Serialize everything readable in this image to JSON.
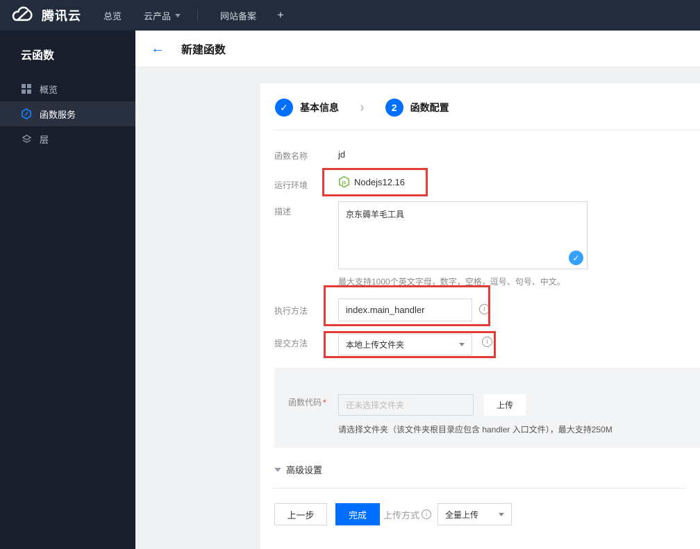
{
  "topnav": {
    "brand": "腾讯云",
    "items": [
      {
        "label": "总览"
      },
      {
        "label": "云产品"
      },
      {
        "label": "网站备案"
      },
      {
        "label": "+"
      }
    ]
  },
  "sidebar": {
    "title": "云函数",
    "items": [
      {
        "label": "概览",
        "icon": "grid-icon",
        "active": false
      },
      {
        "label": "函数服务",
        "icon": "function-hexagon-icon",
        "active": true
      },
      {
        "label": "层",
        "icon": "layers-icon",
        "active": false
      }
    ]
  },
  "header": {
    "back": "←",
    "title": "新建函数"
  },
  "steps": [
    {
      "num": "✓",
      "label": "基本信息",
      "state": "done"
    },
    {
      "num": "2",
      "label": "函数配置",
      "state": "current"
    }
  ],
  "form": {
    "name_label": "函数名称",
    "name_value": "jd",
    "runtime_label": "运行环境",
    "runtime_value": "Nodejs12.16",
    "runtime_icon": "nodejs-icon",
    "desc_label": "描述",
    "desc_value": "京东薅羊毛工具",
    "desc_help": "最大支持1000个英文字母，数字，空格，逗号、句号、中文。",
    "handler_label": "执行方法",
    "handler_value": "index.main_handler",
    "submit_label": "提交方法",
    "submit_value": "本地上传文件夹",
    "code_label": "函数代码",
    "code_required": "*",
    "code_placeholder": "还未选择文件夹",
    "upload_button": "上传",
    "code_help": "请选择文件夹（该文件夹根目录应包含 handler 入口文件），最大支持250M",
    "advanced_label": "高级设置"
  },
  "footer": {
    "prev": "上一步",
    "finish": "完成",
    "upload_mode_label": "上传方式",
    "upload_mode_value": "全量上传"
  },
  "colors": {
    "accent_blue": "#006eff",
    "badge_blue": "#36a0ff",
    "annotation_red": "#e23c39",
    "node_green": "#6fb73c",
    "topnav_bg": "#232c3d",
    "sidebar_bg": "#181e2b"
  }
}
